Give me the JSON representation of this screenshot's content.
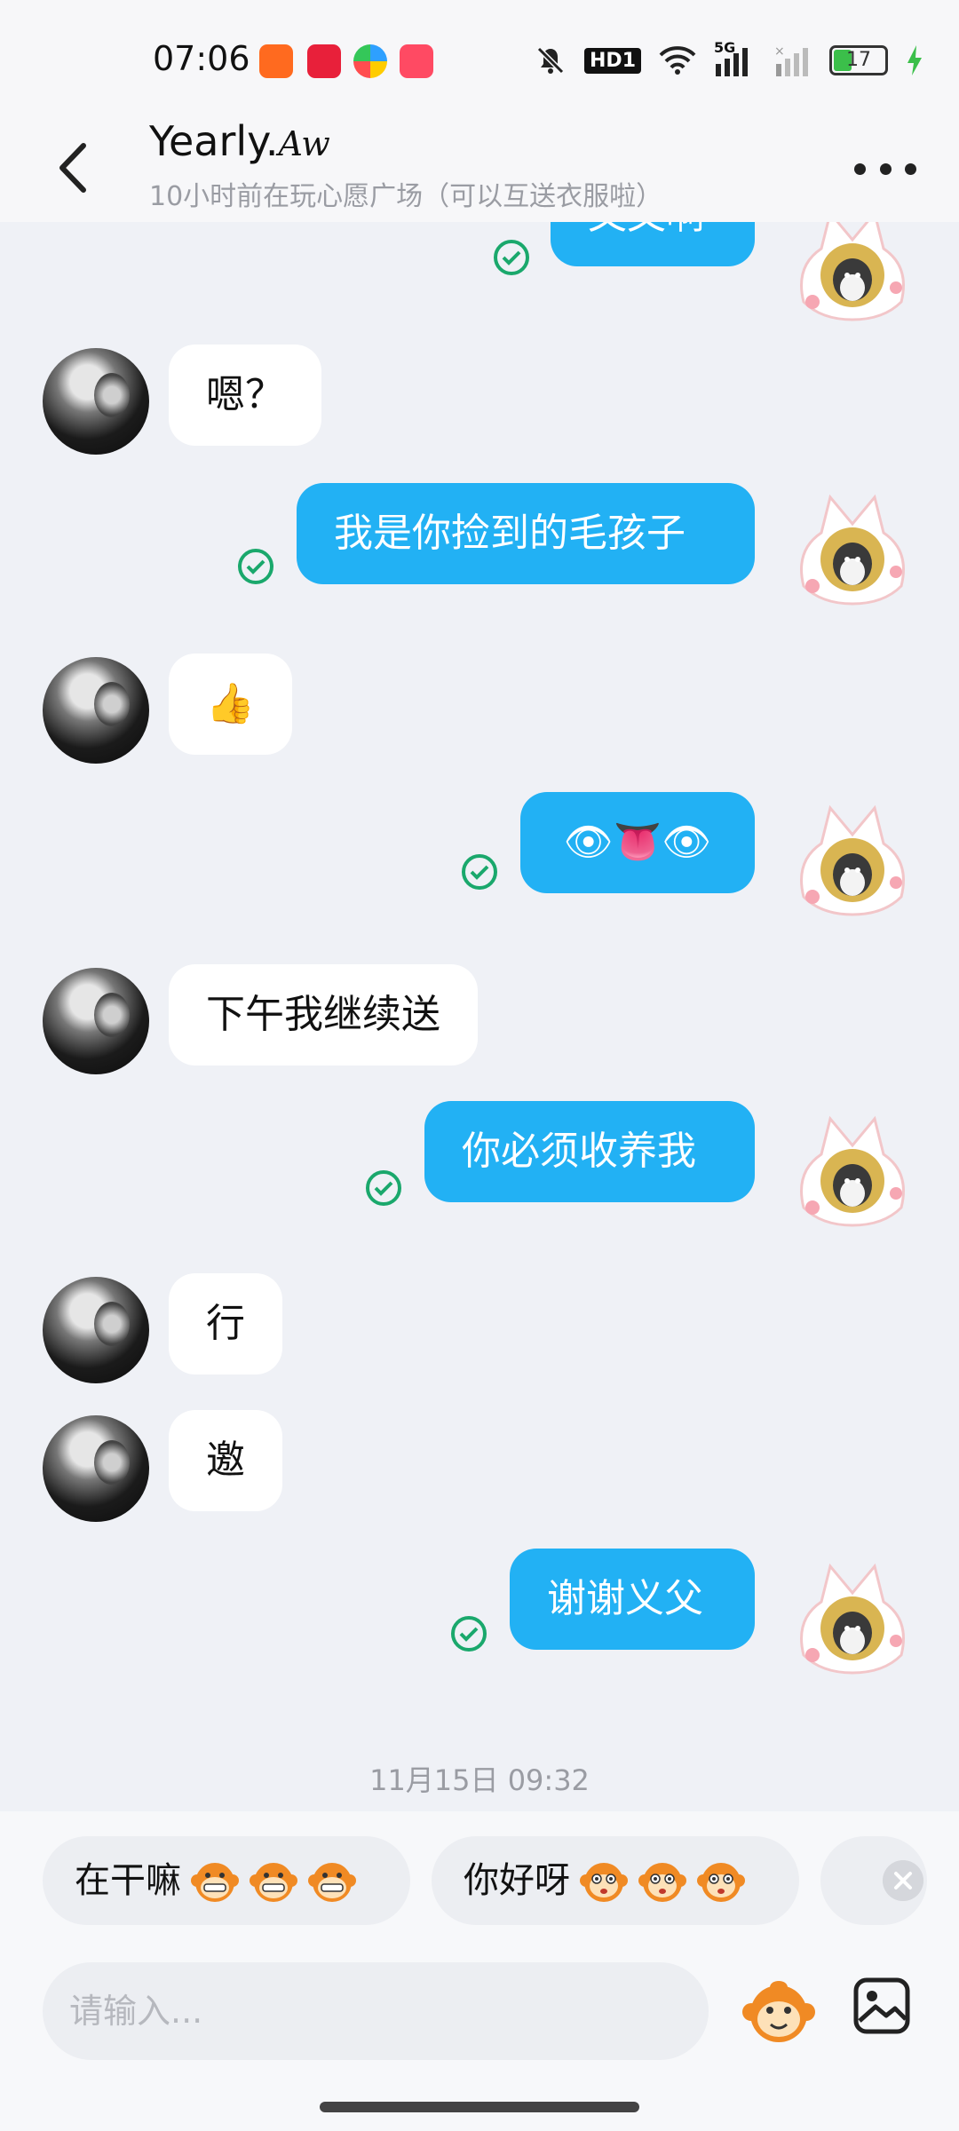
{
  "status_bar": {
    "time": "07:06",
    "hd_label": "HD1",
    "battery": "17",
    "signal_label": "5G"
  },
  "header": {
    "name": "Yearly.",
    "name_sig": "Aw",
    "status": "10小时前在玩心愿广场（可以互送衣服啦）"
  },
  "messages": [
    {
      "side": "out",
      "text": "文文啊"
    },
    {
      "side": "in",
      "text": "嗯？"
    },
    {
      "side": "out",
      "text": "我是你捡到的毛孩子"
    },
    {
      "side": "in",
      "text": "👍"
    },
    {
      "side": "out",
      "text": "👁👅👁"
    },
    {
      "side": "in",
      "text": "下午我继续送"
    },
    {
      "side": "out",
      "text": "你必须收养我"
    },
    {
      "side": "in",
      "text": "行"
    },
    {
      "side": "in",
      "text": "邀"
    },
    {
      "side": "out",
      "text": "谢谢义父"
    }
  ],
  "timestamp": "11月15日 09:32",
  "quick_replies": [
    {
      "text": "在干嘛",
      "icon": "grinning-monkey-icon"
    },
    {
      "text": "你好呀",
      "icon": "waving-monkey-icon"
    }
  ],
  "input": {
    "placeholder": "请输入..."
  },
  "colors": {
    "outgoing_bubble": "#22b1f4",
    "incoming_bubble": "#ffffff",
    "read_check": "#1aa86c"
  }
}
